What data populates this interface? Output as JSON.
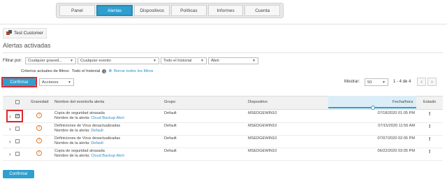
{
  "nav": {
    "tabs": [
      "Panel",
      "Alertas",
      "Dispositivos",
      "Políticas",
      "Informes",
      "Cuenta"
    ],
    "active": "Alertas"
  },
  "customer": {
    "name": "Test Customer"
  },
  "page_title": "Alertas activadas",
  "filters": {
    "label": "Filtrar por:",
    "severity": "Cualquier graved...",
    "event": "Cualquier evento",
    "history": "Todo el historial",
    "open": "Abrir",
    "criteria_label": "Criterios actuales de filtros:",
    "criteria_value": "Todo el historial",
    "clear_link": "Borrar todos los filtros"
  },
  "toolbar": {
    "confirm": "Confirmar",
    "actions": "Acciones",
    "show_label": "Mostrar:",
    "show_value": "50",
    "range": "1 - 4 de 4"
  },
  "table": {
    "headers": [
      "Gravedad",
      "Nombre del evento/la alerta",
      "Grupo",
      "Dispositivo",
      "Fecha/hora",
      "Estado"
    ],
    "rows": [
      {
        "event": "Copia de seguridad atrasada",
        "alert_label": "Nombre de la alerta:",
        "alert_name": "Cloud Backup Alert",
        "group": "Default",
        "device": "MSEDGEWIN10",
        "datetime": "07/18/2020 01:05 PM",
        "status": "!",
        "checked": true
      },
      {
        "event": "Definiciones de Virus desactualizadas",
        "alert_label": "Nombre de la alerta:",
        "alert_name": "Default",
        "group": "Default",
        "device": "MSEDGEWIN10",
        "datetime": "07/15/2020 11:56 AM",
        "status": "!",
        "checked": false
      },
      {
        "event": "Definiciones de Virus desactualizadas",
        "alert_label": "Nombre de la alerta:",
        "alert_name": "Default",
        "group": "Default",
        "device": "MSEDGEWIN10",
        "datetime": "07/07/2020 02:05 PM",
        "status": "!",
        "checked": false
      },
      {
        "event": "Copia de seguridad atrasada",
        "alert_label": "Nombre de la alerta:",
        "alert_name": "Cloud Backup Alert",
        "group": "Default",
        "device": "MSEDGEWIN10",
        "datetime": "06/22/2020 03:05 PM",
        "status": "!",
        "checked": false
      }
    ]
  },
  "footer": {
    "confirm": "Confirmar"
  },
  "colors": {
    "accent": "#2e9fcf",
    "highlight": "#e0262b",
    "warning": "#e07b2c"
  }
}
